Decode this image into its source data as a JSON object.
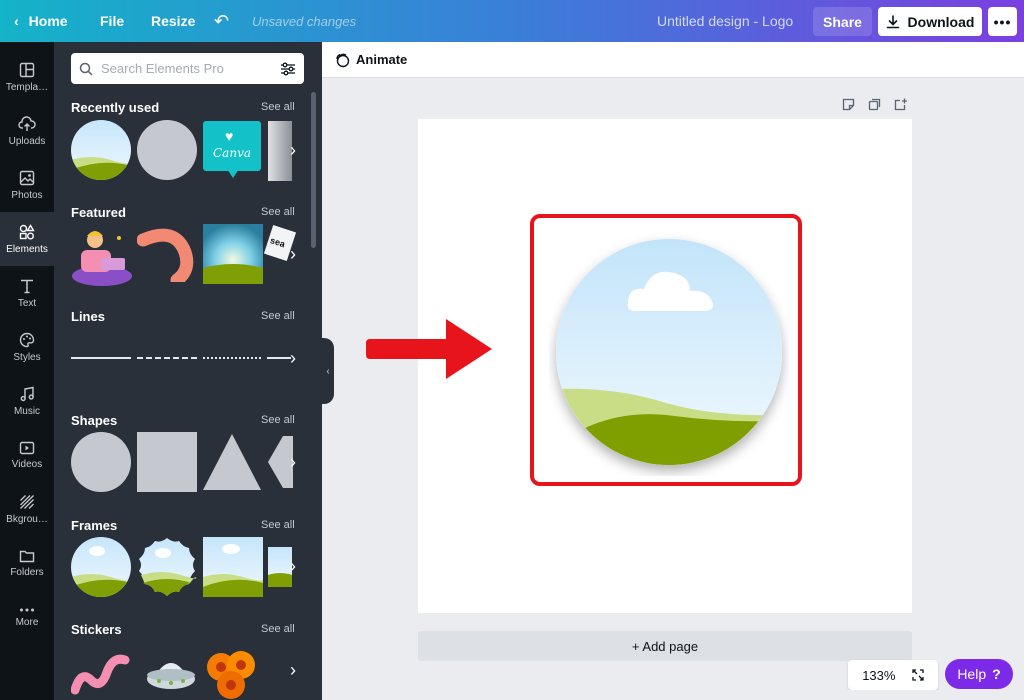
{
  "topbar": {
    "home_label": "Home",
    "file_label": "File",
    "resize_label": "Resize",
    "unsaved_text": "Unsaved changes",
    "design_title": "Untitled design - Logo",
    "share_label": "Share",
    "download_label": "Download",
    "more_label": "•••"
  },
  "rail": {
    "items": [
      {
        "label": "Templa…",
        "icon": "templates-icon"
      },
      {
        "label": "Uploads",
        "icon": "upload-icon"
      },
      {
        "label": "Photos",
        "icon": "photo-icon"
      },
      {
        "label": "Elements",
        "icon": "elements-icon",
        "active": true
      },
      {
        "label": "Text",
        "icon": "text-icon"
      },
      {
        "label": "Styles",
        "icon": "palette-icon"
      },
      {
        "label": "Music",
        "icon": "music-icon"
      },
      {
        "label": "Videos",
        "icon": "video-icon"
      },
      {
        "label": "Bkgrou…",
        "icon": "background-icon"
      },
      {
        "label": "Folders",
        "icon": "folder-icon"
      },
      {
        "label": "More",
        "icon": "more-icon"
      }
    ]
  },
  "search": {
    "placeholder": "Search Elements Pro",
    "filter_icon": "filter-icon"
  },
  "sections": {
    "recently_used": {
      "title": "Recently used",
      "see_all": "See all",
      "canva_logo_text": "Canva"
    },
    "featured": {
      "title": "Featured",
      "see_all": "See all",
      "sticker_text": "sea"
    },
    "lines": {
      "title": "Lines",
      "see_all": "See all"
    },
    "shapes": {
      "title": "Shapes",
      "see_all": "See all"
    },
    "frames": {
      "title": "Frames",
      "see_all": "See all"
    },
    "stickers": {
      "title": "Stickers",
      "see_all": "See all"
    }
  },
  "workspace": {
    "animate_label": "Animate",
    "add_page_label": "+ Add page",
    "zoom_label": "133%",
    "help_label": "Help",
    "help_icon": "?"
  },
  "colors": {
    "accent_purple": "#7d2ae8",
    "highlight_red": "#e8141c",
    "panel_bg": "#293039",
    "rail_bg": "#0e1318",
    "sky": "#d8effd",
    "grass_dark": "#7f9f05",
    "grass_light": "#c8dd86"
  }
}
